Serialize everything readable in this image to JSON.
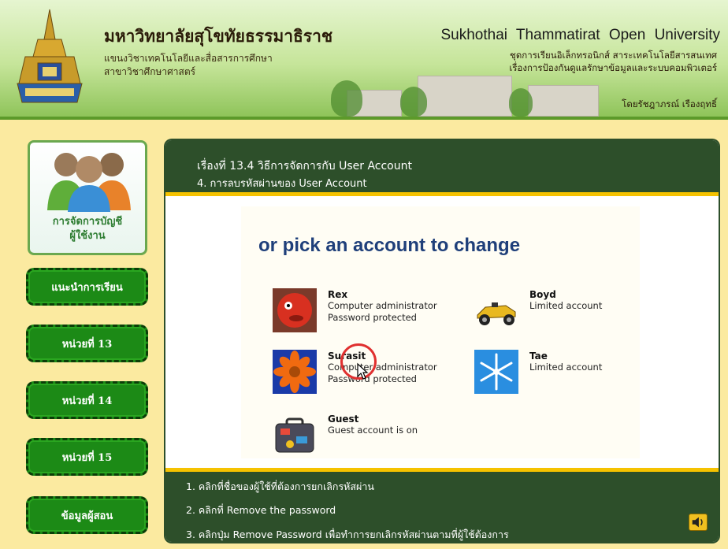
{
  "header": {
    "thai_title": "มหาวิทยาลัยสุโขทัยธรรมาธิราช",
    "thai_sub_1": "แขนงวิชาเทคโนโลยีและสื่อสารการศึกษา",
    "thai_sub_2": "สาขาวิชาศึกษาศาสตร์",
    "en_title": "Sukhothai Thammatirat Open University",
    "series_1": "ชุดการเรียนอิเล็กทรอนิกส์ สาระเทคโนโลยีสารสนเทศ",
    "series_2": "เรื่องการป้องกันดูแลรักษาข้อมูลและระบบคอมพิวเตอร์",
    "author": "โดยรัชฎาภรณ์ เรืองฤทธิ์"
  },
  "sidebar": {
    "profile_label": "การจัดการบัญชี\nผู้ใช้งาน",
    "items": [
      {
        "label": "แนะนำการเรียน"
      },
      {
        "label": "หน่วยที่ 13"
      },
      {
        "label": "หน่วยที่ 14"
      },
      {
        "label": "หน่วยที่ 15"
      },
      {
        "label": "ข้อมูลผู้สอน"
      }
    ]
  },
  "main": {
    "heading_1": "เรื่องที่ 13.4 วิธีการจัดการกับ User Account",
    "heading_2": "4. การลบรหัสผ่านของ User Account",
    "pick_title": "or pick an account to change",
    "accounts": [
      {
        "name": "Rex",
        "line1": "Computer administrator",
        "line2": "Password protected",
        "icon": "red-fish-icon"
      },
      {
        "name": "Boyd",
        "line1": "Limited account",
        "line2": "",
        "icon": "race-car-icon"
      },
      {
        "name": "Surasit",
        "line1": "Computer administrator",
        "line2": "Password protected",
        "icon": "orange-flower-icon"
      },
      {
        "name": "Tae",
        "line1": "Limited account",
        "line2": "",
        "icon": "snowflake-icon"
      },
      {
        "name": "Guest",
        "line1": "Guest account is on",
        "line2": "",
        "icon": "suitcase-icon"
      }
    ],
    "steps": [
      "1. คลิกที่ชื่อของผู้ใช้ที่ต้องการยกเลิกรหัสผ่าน",
      "2. คลิกที่ Remove the password",
      "3. คลิกปุ่ม Remove Password เพื่อทำการยกเลิกรหัสผ่านตามที่ผู้ใช้ต้องการ"
    ]
  },
  "colors": {
    "panel_green": "#2d4f2a",
    "nav_green": "#1c8a16",
    "accent_yellow": "#f5c200",
    "title_blue": "#1f3f7a"
  }
}
